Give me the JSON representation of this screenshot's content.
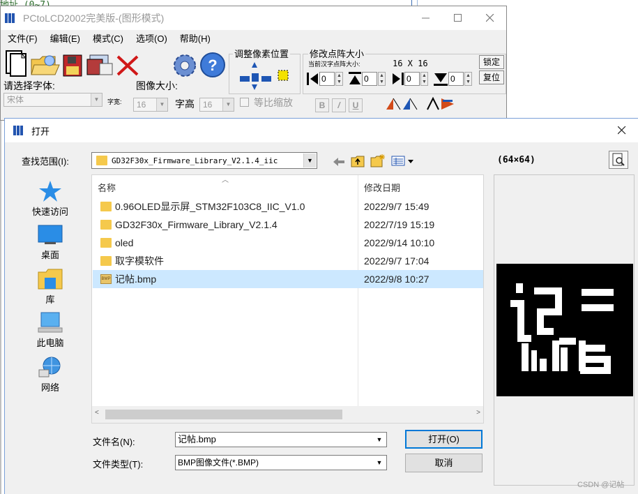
{
  "background": {
    "top_text": "地址 (0~7)"
  },
  "pc_window": {
    "title": "PCtoLCD2002完美版-(图形模式)",
    "menu": [
      "文件(F)",
      "编辑(E)",
      "模式(C)",
      "选项(O)",
      "帮助(H)"
    ],
    "font_label": "请选择字体:",
    "font_value": "宋体",
    "image_size_label": "图像大小:",
    "char_width_label": "字宽:",
    "char_width_value": "16",
    "char_height_label": "字高",
    "char_height_value": "16",
    "scale_label": "等比缩放",
    "adjust_label": "调整像素位置",
    "resize_label": "修改点阵大小",
    "current_size_label": "当前汉字点阵大小:",
    "current_size_value": "16 X 16",
    "lock_label": "锁定",
    "reset_label": "复位",
    "spin_values": [
      "0",
      "0",
      "0",
      "0"
    ],
    "format_buttons": [
      "B",
      "/",
      "U"
    ]
  },
  "dialog": {
    "title": "打开",
    "look_in_label": "查找范围(I):",
    "look_in_value": "GD32F30x_Firmware_Library_V2.1.4_iic",
    "places": [
      "快速访问",
      "桌面",
      "库",
      "此电脑",
      "网络"
    ],
    "columns": {
      "name": "名称",
      "date": "修改日期"
    },
    "files": [
      {
        "name": "0.96OLED显示屏_STM32F103C8_IIC_V1.0",
        "date": "2022/9/7 15:49",
        "type": "folder"
      },
      {
        "name": "GD32F30x_Firmware_Library_V2.1.4",
        "date": "2022/7/19 15:19",
        "type": "folder"
      },
      {
        "name": "oled",
        "date": "2022/9/14 10:10",
        "type": "folder"
      },
      {
        "name": "取字模软件",
        "date": "2022/9/7 17:04",
        "type": "folder"
      },
      {
        "name": "记帖.bmp",
        "date": "2022/9/8 10:27",
        "type": "bmp",
        "selected": true
      }
    ],
    "preview_size": "(64×64)",
    "file_name_label": "文件名(N):",
    "file_name_value": "记帖.bmp",
    "file_type_label": "文件类型(T):",
    "file_type_value": "BMP图像文件(*.BMP)",
    "open_button": "打开(O)",
    "cancel_button": "取消",
    "bmp_badge": "BMP"
  },
  "watermark": "CSDN @记帖",
  "colors": {
    "selection": "#cce8ff",
    "accent": "#0078d7",
    "folder": "#f5c94c"
  }
}
